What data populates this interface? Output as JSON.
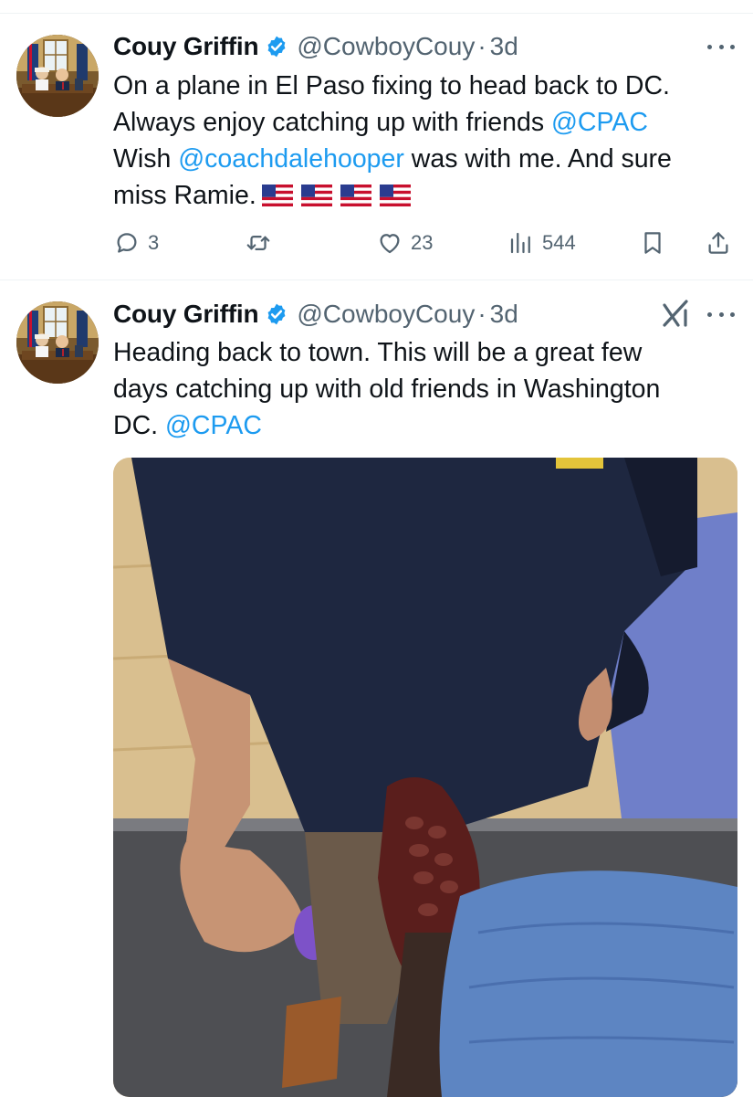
{
  "tweets": [
    {
      "author": {
        "name": "Couy Griffin",
        "handle": "@CowboyCouy",
        "separator": "·",
        "time": "3d",
        "avatar_icon": "profile-photo"
      },
      "text": {
        "line1": "On a plane in El Paso fixing to head back to DC.",
        "line2_prefix": "Always enjoy catching up with friends ",
        "mention1": "@CPAC",
        "line3_prefix": "Wish ",
        "mention2": "@coachdalehooper",
        "line3_suffix": " was with me. And sure",
        "line4": "miss Ramie.",
        "emoji_flags": 4
      },
      "actions": {
        "replies": "3",
        "reposts": "",
        "likes": "23",
        "views": "544"
      }
    },
    {
      "author": {
        "name": "Couy Griffin",
        "handle": "@CowboyCouy",
        "separator": "·",
        "time": "3d",
        "avatar_icon": "profile-photo"
      },
      "text": {
        "line1": "Heading back to town. This will be a great few",
        "line2": "days catching up with old friends in Washington",
        "line3_prefix": "DC. ",
        "mention1": "@CPAC"
      },
      "media": {
        "description_icon": "photo-boots-on-plane"
      }
    }
  ],
  "colors": {
    "accent": "#1d9bf0",
    "muted": "#536471",
    "text": "#0f1419",
    "divider": "#eff3f4"
  }
}
